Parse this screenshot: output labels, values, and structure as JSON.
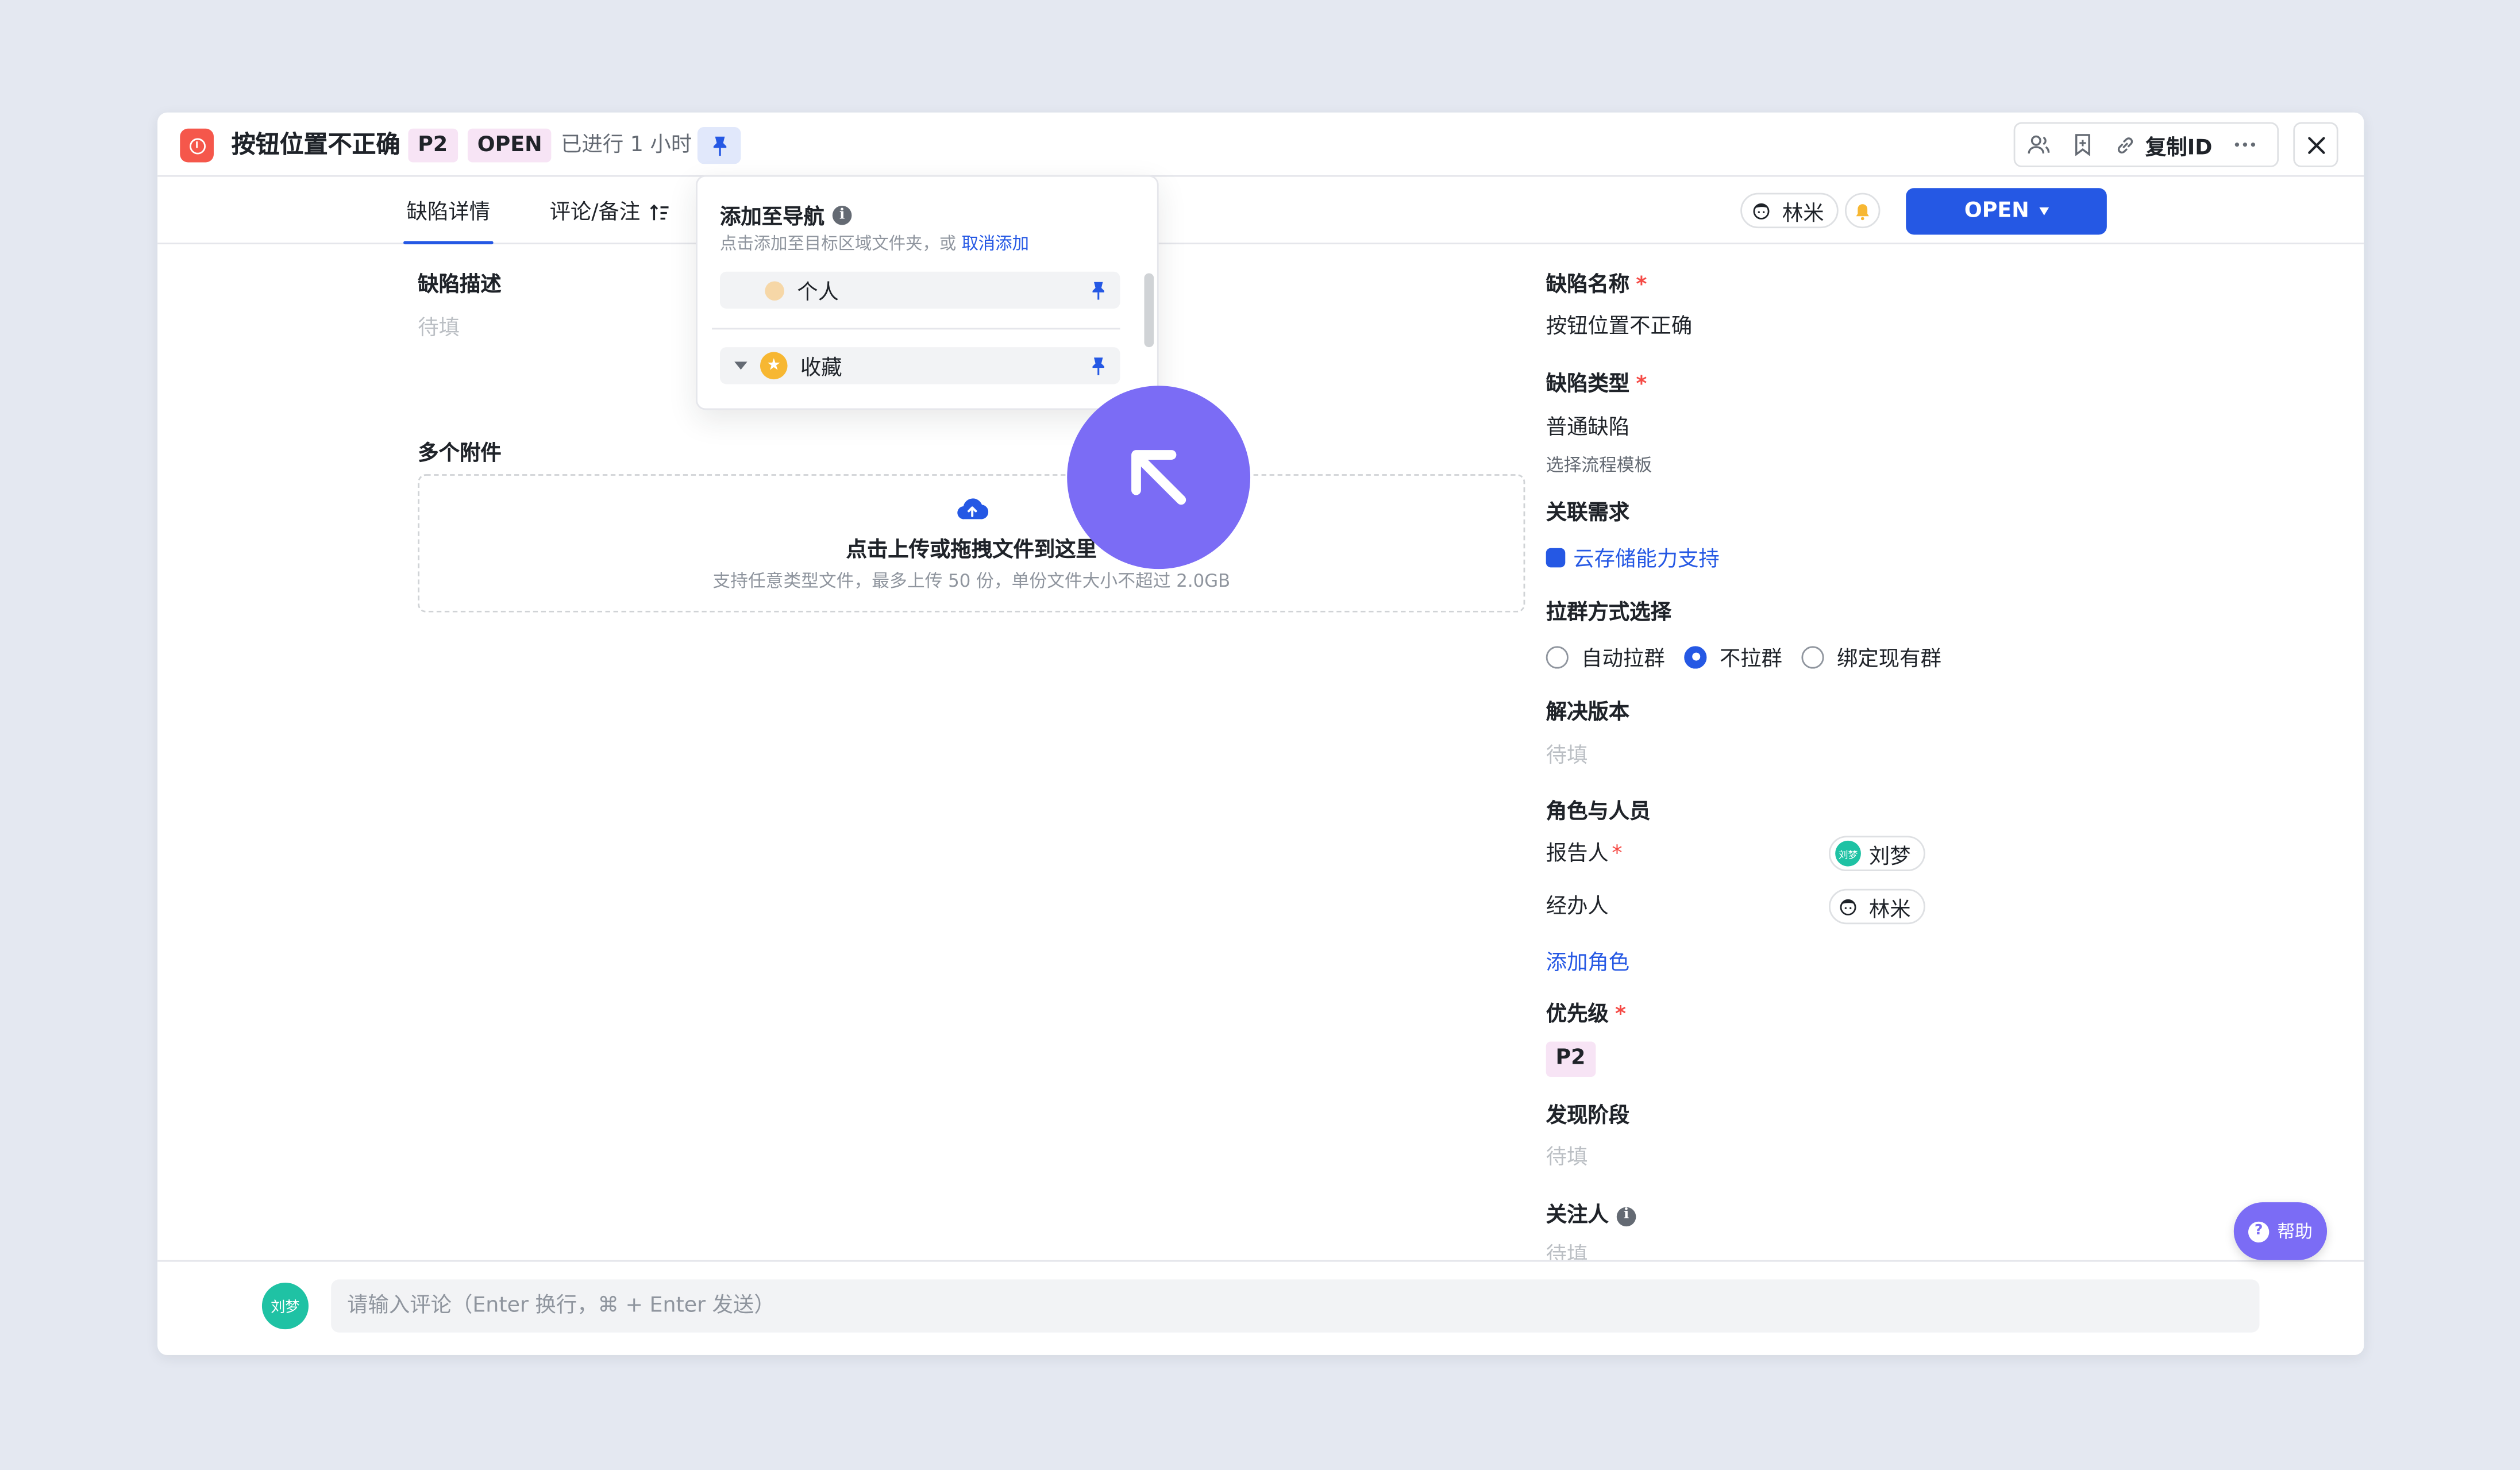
{
  "header": {
    "title": "按钮位置不正确",
    "priority_tag": "P2",
    "status_tag": "OPEN",
    "elapsed": "已进行 1 小时",
    "copy_id_label": "复制ID"
  },
  "tabs": [
    {
      "label": "缺陷详情",
      "active": true
    },
    {
      "label": "评论/备注",
      "active": false
    }
  ],
  "assignee_chip": "林米",
  "status_button": "OPEN",
  "left": {
    "description_label": "缺陷描述",
    "description_placeholder": "待填",
    "attachments_label": "多个附件",
    "upload_title": "点击上传或拖拽文件到这里",
    "upload_hint": "支持任意类型文件，最多上传 50 份，单份文件大小不超过 2.0GB"
  },
  "right": {
    "name_label": "缺陷名称",
    "name_value": "按钮位置不正确",
    "type_label": "缺陷类型",
    "type_value": "普通缺陷",
    "type_sub": "选择流程模板",
    "linked_label": "关联需求",
    "linked_value": "云存储能力支持",
    "group_label": "拉群方式选择",
    "group_options": [
      "自动拉群",
      "不拉群",
      "绑定现有群"
    ],
    "group_selected": "不拉群",
    "version_label": "解决版本",
    "version_placeholder": "待填",
    "roles_label": "角色与人员",
    "reporter_label": "报告人",
    "reporter_name": "刘梦",
    "reporter_avatar": "刘梦",
    "handler_label": "经办人",
    "handler_name": "林米",
    "add_role": "添加角色",
    "priority_label": "优先级",
    "priority_value": "P2",
    "stage_label": "发现阶段",
    "stage_placeholder": "待填",
    "watchers_label": "关注人",
    "watchers_placeholder": "待填"
  },
  "popover": {
    "title": "添加至导航",
    "hint": "点击添加至目标区域文件夹，或",
    "hint_link": "取消添加",
    "items": [
      {
        "label": "个人"
      },
      {
        "label": "收藏"
      }
    ]
  },
  "bottom": {
    "avatar_text": "刘梦",
    "comment_placeholder": "请输入评论（Enter 换行，⌘ + Enter 发送）"
  },
  "help_label": "帮助",
  "colors": {
    "primary": "#2558e4",
    "bug_red": "#f5574b",
    "priority_bg": "#f7e4f5",
    "cursor_purple": "#7b6cf5"
  }
}
